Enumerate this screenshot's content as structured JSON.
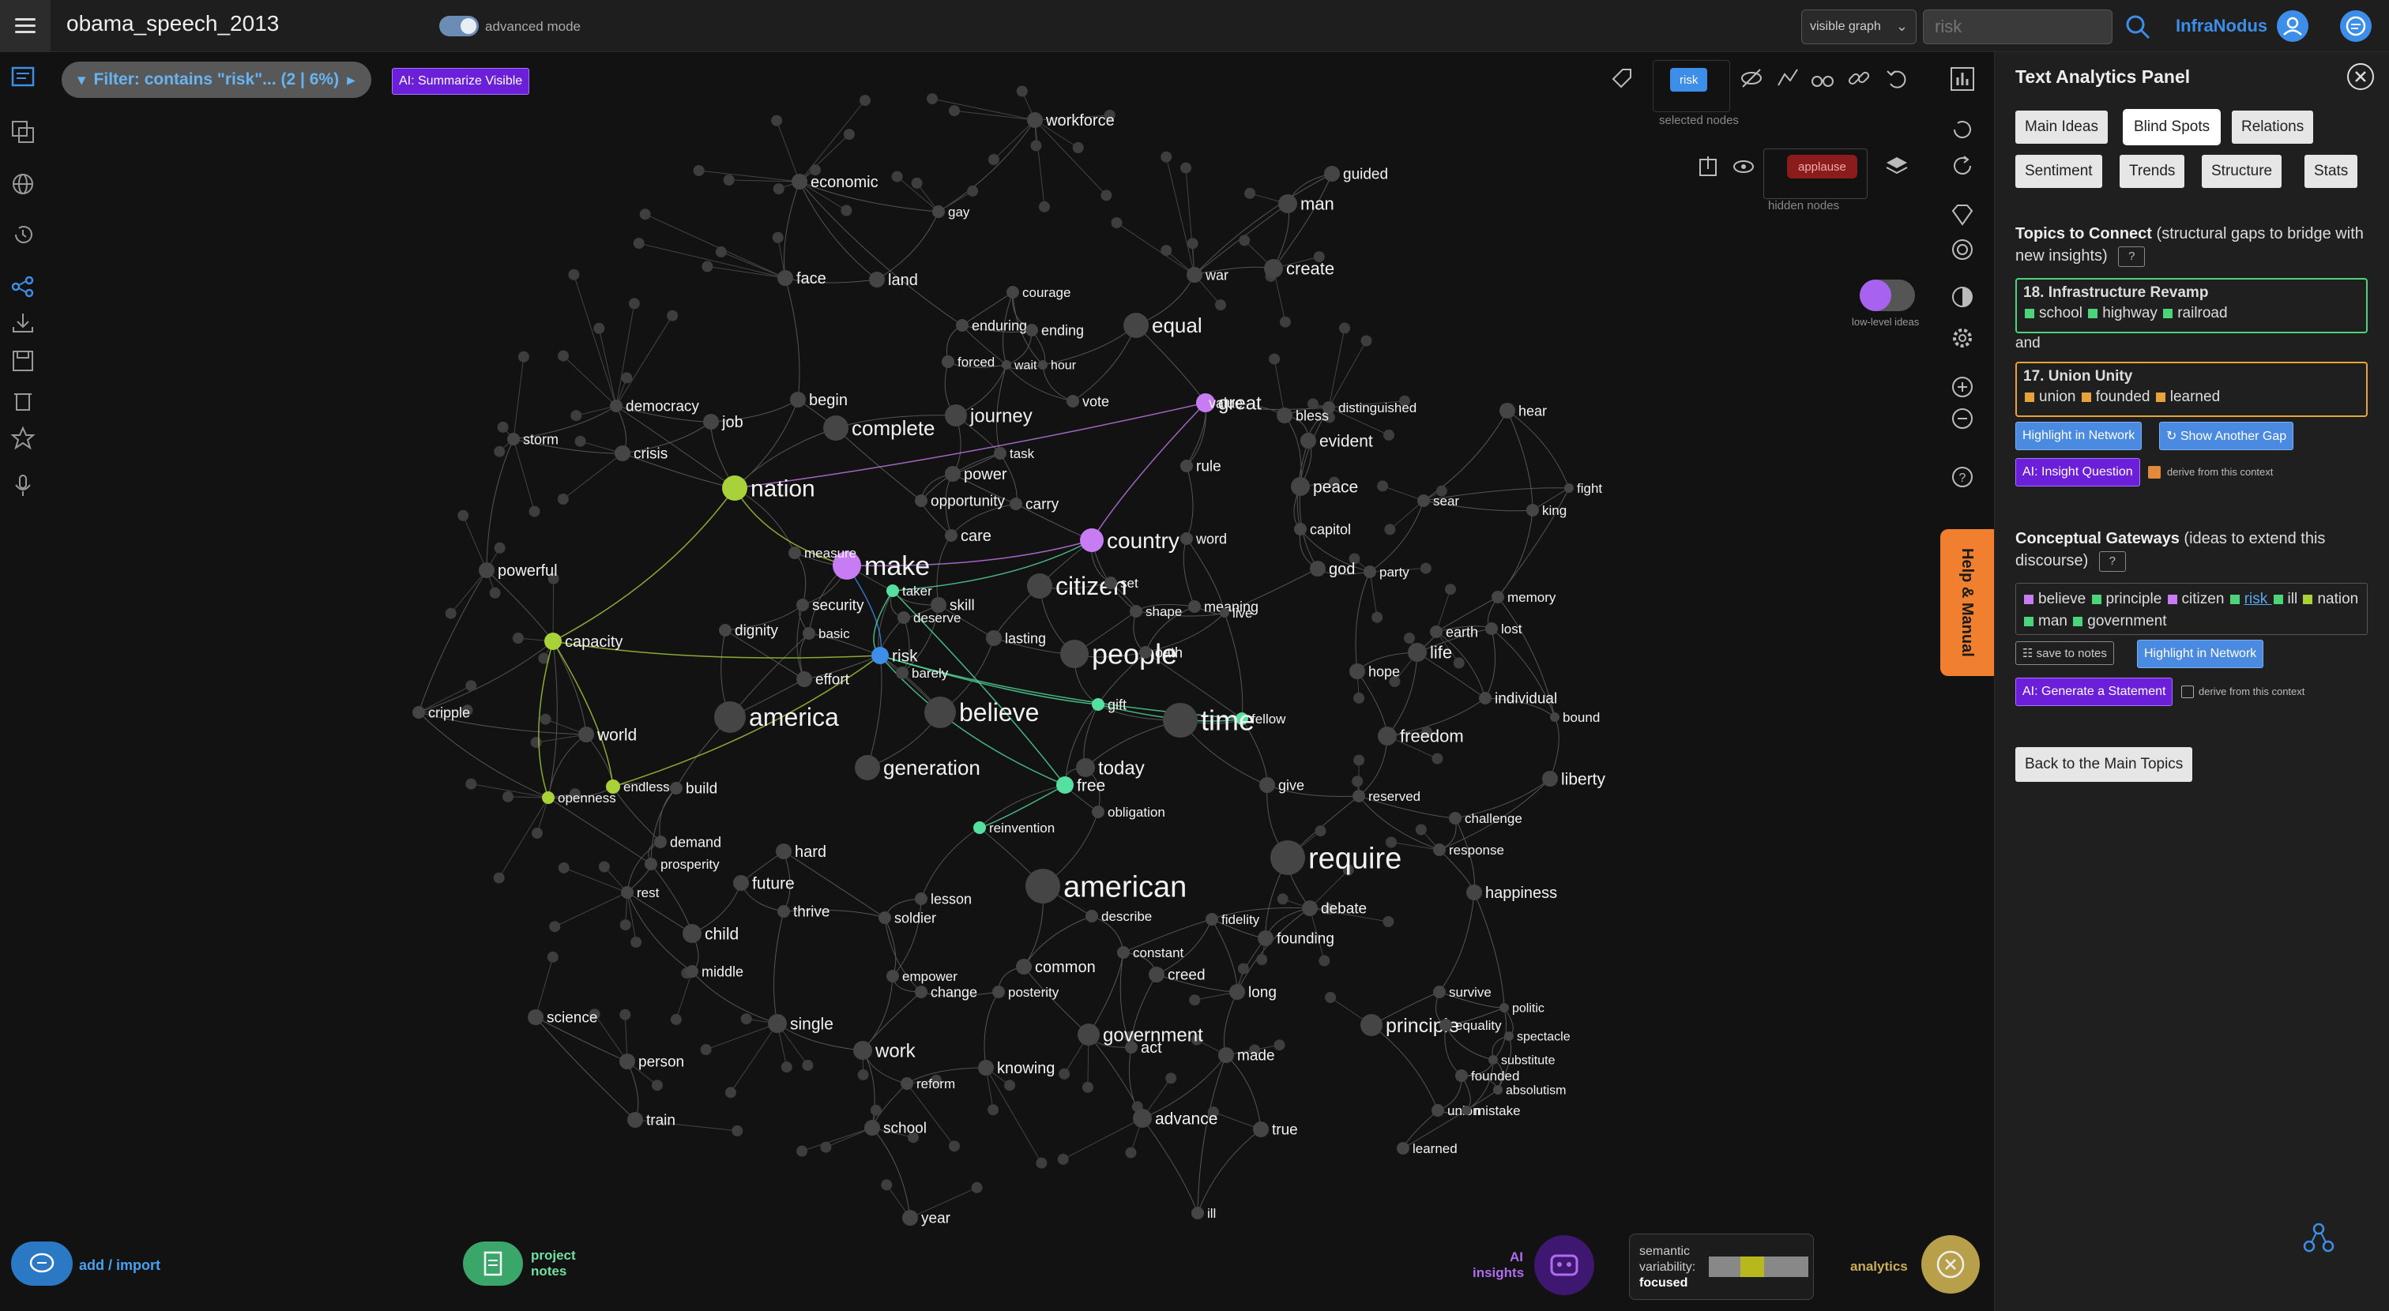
{
  "app": {
    "document_title": "obama_speech_2013",
    "advanced_mode_label": "advanced mode",
    "graph_select_value": "visible graph",
    "search_placeholder": "risk",
    "brand": "InfraNodus"
  },
  "filter": {
    "label": "Filter: contains \"risk\"... (2 | 6%)",
    "summarize_button": "AI: Summarize Visible"
  },
  "graph_tools": {
    "selected_node_chip": "risk",
    "selected_nodes_label": "selected nodes",
    "hidden_node_chip": "applause",
    "hidden_nodes_label": "hidden nodes",
    "low_level_ideas_label": "low-level ideas"
  },
  "help_tab": "Help & Manual",
  "colors": {
    "accent_blue": "#3c8ee8",
    "node_violet": "#c77cf4",
    "node_lime": "#a9d13a",
    "node_green": "#55e0a0",
    "node_gray": "#454545",
    "ai_purple": "#6b1fd8",
    "help_orange": "#f08030"
  },
  "graph_nodes": [
    {
      "word": "nation",
      "hl": "lime"
    },
    {
      "word": "make",
      "hl": "violet"
    },
    {
      "word": "country",
      "hl": "violet"
    },
    {
      "word": "great",
      "hl": "violet"
    },
    {
      "word": "value",
      "hl": "violet"
    },
    {
      "word": "capacity",
      "hl": "lime"
    },
    {
      "word": "openness",
      "hl": "lime"
    },
    {
      "word": "endless",
      "hl": "lime"
    },
    {
      "word": "risk",
      "hl": "blue"
    },
    {
      "word": "taker",
      "hl": "green"
    },
    {
      "word": "gift",
      "hl": "green"
    },
    {
      "word": "fellow",
      "hl": "green"
    },
    {
      "word": "free",
      "hl": "green"
    },
    {
      "word": "reinvention",
      "hl": "green"
    },
    {
      "word": "citizen"
    },
    {
      "word": "people"
    },
    {
      "word": "america"
    },
    {
      "word": "believe"
    },
    {
      "word": "time"
    },
    {
      "word": "american"
    },
    {
      "word": "require"
    },
    {
      "word": "generation"
    },
    {
      "word": "today"
    },
    {
      "word": "equal"
    },
    {
      "word": "complete"
    },
    {
      "word": "journey"
    },
    {
      "word": "man"
    },
    {
      "word": "create"
    },
    {
      "word": "economic"
    },
    {
      "word": "workforce"
    },
    {
      "word": "guided"
    },
    {
      "word": "gay"
    },
    {
      "word": "face"
    },
    {
      "word": "land"
    },
    {
      "word": "courage"
    },
    {
      "word": "war"
    },
    {
      "word": "enduring"
    },
    {
      "word": "ending"
    },
    {
      "word": "forced"
    },
    {
      "word": "wait"
    },
    {
      "word": "hour"
    },
    {
      "word": "democracy"
    },
    {
      "word": "job"
    },
    {
      "word": "begin"
    },
    {
      "word": "vote"
    },
    {
      "word": "bless"
    },
    {
      "word": "distinguished"
    },
    {
      "word": "hear"
    },
    {
      "word": "storm"
    },
    {
      "word": "crisis"
    },
    {
      "word": "task"
    },
    {
      "word": "evident"
    },
    {
      "word": "power"
    },
    {
      "word": "rule"
    },
    {
      "word": "opportunity"
    },
    {
      "word": "carry"
    },
    {
      "word": "peace"
    },
    {
      "word": "fight"
    },
    {
      "word": "sear"
    },
    {
      "word": "king"
    },
    {
      "word": "care"
    },
    {
      "word": "word"
    },
    {
      "word": "capitol"
    },
    {
      "word": "measure"
    },
    {
      "word": "god"
    },
    {
      "word": "party"
    },
    {
      "word": "powerful"
    },
    {
      "word": "set"
    },
    {
      "word": "memory"
    },
    {
      "word": "security"
    },
    {
      "word": "skill"
    },
    {
      "word": "shape"
    },
    {
      "word": "meaning"
    },
    {
      "word": "live"
    },
    {
      "word": "deserve"
    },
    {
      "word": "earth"
    },
    {
      "word": "lost"
    },
    {
      "word": "dignity"
    },
    {
      "word": "basic"
    },
    {
      "word": "lasting"
    },
    {
      "word": "oath"
    },
    {
      "word": "life"
    },
    {
      "word": "effort"
    },
    {
      "word": "barely"
    },
    {
      "word": "hope"
    },
    {
      "word": "individual"
    },
    {
      "word": "cripple"
    },
    {
      "word": "bound"
    },
    {
      "word": "world"
    },
    {
      "word": "freedom"
    },
    {
      "word": "build"
    },
    {
      "word": "liberty"
    },
    {
      "word": "give"
    },
    {
      "word": "obligation"
    },
    {
      "word": "reserved"
    },
    {
      "word": "challenge"
    },
    {
      "word": "demand"
    },
    {
      "word": "hard"
    },
    {
      "word": "response"
    },
    {
      "word": "prosperity"
    },
    {
      "word": "future"
    },
    {
      "word": "rest"
    },
    {
      "word": "lesson"
    },
    {
      "word": "happiness"
    },
    {
      "word": "thrive"
    },
    {
      "word": "soldier"
    },
    {
      "word": "describe"
    },
    {
      "word": "fidelity"
    },
    {
      "word": "debate"
    },
    {
      "word": "child"
    },
    {
      "word": "founding"
    },
    {
      "word": "constant"
    },
    {
      "word": "middle"
    },
    {
      "word": "empower"
    },
    {
      "word": "common"
    },
    {
      "word": "creed"
    },
    {
      "word": "change"
    },
    {
      "word": "posterity"
    },
    {
      "word": "long"
    },
    {
      "word": "survive"
    },
    {
      "word": "science"
    },
    {
      "word": "politic"
    },
    {
      "word": "single"
    },
    {
      "word": "principle"
    },
    {
      "word": "equality"
    },
    {
      "word": "government"
    },
    {
      "word": "spectacle"
    },
    {
      "word": "work"
    },
    {
      "word": "act"
    },
    {
      "word": "made"
    },
    {
      "word": "substitute"
    },
    {
      "word": "person"
    },
    {
      "word": "knowing"
    },
    {
      "word": "founded"
    },
    {
      "word": "reform"
    },
    {
      "word": "absolutism"
    },
    {
      "word": "union"
    },
    {
      "word": "mistake"
    },
    {
      "word": "train"
    },
    {
      "word": "advance"
    },
    {
      "word": "true"
    },
    {
      "word": "school"
    },
    {
      "word": "learned"
    },
    {
      "word": "year"
    },
    {
      "word": "ill"
    }
  ],
  "bottom": {
    "add_import": "add / import",
    "project_notes": "project notes",
    "ai_insights": "AI insights",
    "semantic_variability_label": "semantic variability:",
    "semantic_variability_value": "focused",
    "analytics": "analytics"
  },
  "panel": {
    "title": "Text Analytics Panel",
    "tabs_row1": [
      "Main Ideas",
      "Blind Spots",
      "Relations"
    ],
    "tabs_row2": [
      "Sentiment",
      "Trends",
      "Structure",
      "Stats"
    ],
    "active_tab": "Blind Spots",
    "topics_to_connect_title": "Topics to Connect",
    "topics_to_connect_desc": "(structural gaps to bridge with new insights)",
    "question_badge": "?",
    "topic_a": {
      "title": "18. Infrastructure Revamp",
      "words": [
        "school",
        "highway",
        "railroad"
      ],
      "color": "#4cd47a"
    },
    "and_text": "and",
    "topic_b": {
      "title": "17. Union Unity",
      "words": [
        "union",
        "founded",
        "learned"
      ],
      "color": "#e8a23a"
    },
    "highlight_button": "Highlight in Network",
    "show_gap_button": "↻ Show Another Gap",
    "insight_question_button": "AI: Insight Question",
    "derive_label": "derive from this context",
    "gateways_title": "Conceptual Gateways",
    "gateways_desc": "(ideas to extend this discourse)",
    "gateways": [
      {
        "word": "believe",
        "color": "#c77cf4"
      },
      {
        "word": "principle",
        "color": "#4cd47a"
      },
      {
        "word": "citizen",
        "color": "#c77cf4"
      },
      {
        "word": "risk",
        "color": "#4cd47a"
      },
      {
        "word": "ill",
        "color": "#4cd47a"
      },
      {
        "word": "nation",
        "color": "#a9d13a"
      },
      {
        "word": "man",
        "color": "#4cd47a"
      },
      {
        "word": "government",
        "color": "#4cd47a"
      }
    ],
    "save_to_notes": "☷ save to notes",
    "generate_statement_button": "AI: Generate a Statement",
    "back_button": "Back to the Main Topics"
  }
}
